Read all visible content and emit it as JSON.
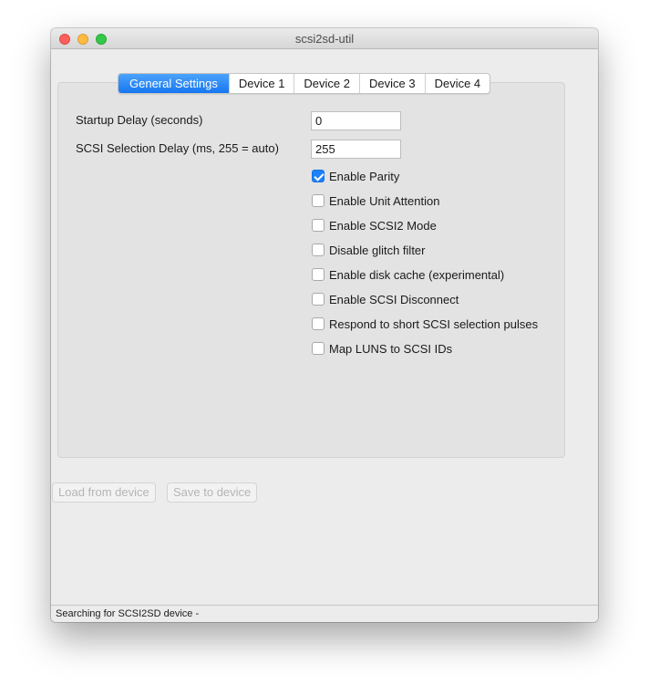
{
  "window": {
    "title": "scsi2sd-util"
  },
  "tabs": [
    {
      "label": "General Settings",
      "active": true
    },
    {
      "label": "Device 1",
      "active": false
    },
    {
      "label": "Device 2",
      "active": false
    },
    {
      "label": "Device 3",
      "active": false
    },
    {
      "label": "Device 4",
      "active": false
    }
  ],
  "general": {
    "startup_delay_label": "Startup Delay (seconds)",
    "startup_delay_value": "0",
    "selection_delay_label": "SCSI Selection Delay (ms, 255 = auto)",
    "selection_delay_value": "255",
    "options": [
      {
        "label": "Enable Parity",
        "checked": true
      },
      {
        "label": "Enable Unit Attention",
        "checked": false
      },
      {
        "label": "Enable SCSI2 Mode",
        "checked": false
      },
      {
        "label": "Disable glitch filter",
        "checked": false
      },
      {
        "label": "Enable disk cache (experimental)",
        "checked": false
      },
      {
        "label": "Enable SCSI Disconnect",
        "checked": false
      },
      {
        "label": "Respond to short SCSI selection pulses",
        "checked": false
      },
      {
        "label": "Map LUNS to SCSI IDs",
        "checked": false
      }
    ]
  },
  "actions": {
    "load_label": "Load from device",
    "save_label": "Save to device",
    "enabled": false
  },
  "status": {
    "text": "Searching for SCSI2SD device -"
  },
  "colors": {
    "accent": "#1a82fb",
    "close": "#fc605c",
    "minimize": "#fdbc40",
    "maximize": "#34c84a"
  }
}
